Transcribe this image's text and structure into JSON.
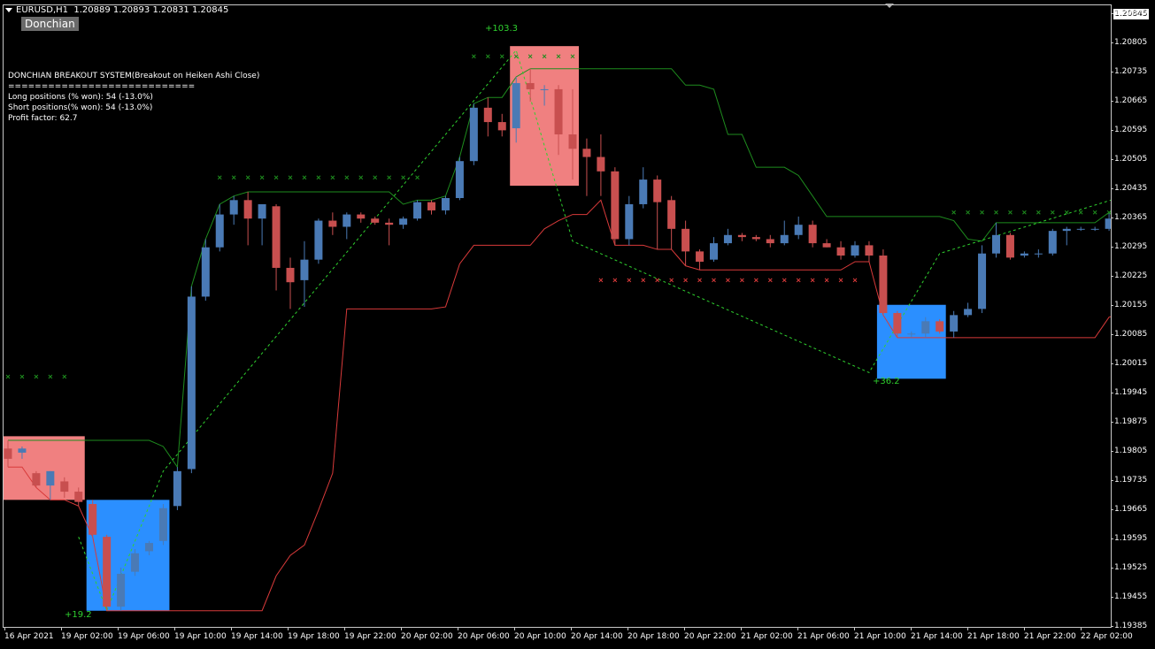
{
  "symbol": {
    "name": "EURUSD,H1",
    "ohlc": "1.20889 1.20893 1.20831 1.20845"
  },
  "indicator_button": "Donchian",
  "stats": {
    "title": "DONCHIAN BREAKOUT SYSTEM(Breakout on Heiken Ashi Close)",
    "separator": "============================",
    "long": "Long positions (% won): 54 (-13.0%)",
    "short": "Short positions(% won): 54 (-13.0%)",
    "profit_factor": "Profit factor: 62.7"
  },
  "current_price": "1.20845",
  "price_axis": [
    "1.20875",
    "1.20805",
    "1.20735",
    "1.20665",
    "1.20595",
    "1.20505",
    "1.20435",
    "1.20365",
    "1.20295",
    "1.20225",
    "1.20155",
    "1.20085",
    "1.20015",
    "1.19945",
    "1.19875",
    "1.19805",
    "1.19735",
    "1.19665",
    "1.19595",
    "1.19525",
    "1.19455",
    "1.19385"
  ],
  "time_axis": [
    "16 Apr 2021",
    "19 Apr 02:00",
    "19 Apr 06:00",
    "19 Apr 10:00",
    "19 Apr 14:00",
    "19 Apr 18:00",
    "19 Apr 22:00",
    "20 Apr 02:00",
    "20 Apr 06:00",
    "20 Apr 10:00",
    "20 Apr 14:00",
    "20 Apr 18:00",
    "20 Apr 22:00",
    "21 Apr 02:00",
    "21 Apr 06:00",
    "21 Apr 10:00",
    "21 Apr 14:00",
    "21 Apr 18:00",
    "21 Apr 22:00",
    "22 Apr 02:00"
  ],
  "trade_labels": [
    "+19.2",
    "+103.3",
    "+36.2"
  ],
  "colors": {
    "background": "#000000",
    "bull": "#4a7ab5",
    "bear": "#c84f4f",
    "upper_channel": "#1e8c1e",
    "lower_channel": "#d83a3a",
    "long_box": "#2b8fff",
    "short_box": "#f08080",
    "trade_line": "#2fd12f",
    "label": "#2fd12f"
  },
  "chart_data": {
    "type": "candlestick",
    "symbol": "EURUSD",
    "timeframe": "H1",
    "yrange": [
      1.19385,
      1.20875
    ],
    "candles": [
      {
        "o": 1.19815,
        "h": 1.19835,
        "l": 1.1977,
        "c": 1.1979
      },
      {
        "o": 1.19805,
        "h": 1.1982,
        "l": 1.1979,
        "c": 1.19815
      },
      {
        "o": 1.19755,
        "h": 1.1976,
        "l": 1.1972,
        "c": 1.19725
      },
      {
        "o": 1.19725,
        "h": 1.1976,
        "l": 1.1969,
        "c": 1.1976
      },
      {
        "o": 1.19735,
        "h": 1.19745,
        "l": 1.19695,
        "c": 1.1971
      },
      {
        "o": 1.1971,
        "h": 1.1972,
        "l": 1.19675,
        "c": 1.19685
      },
      {
        "o": 1.1968,
        "h": 1.1969,
        "l": 1.196,
        "c": 1.19605
      },
      {
        "o": 1.196,
        "h": 1.19605,
        "l": 1.1942,
        "c": 1.1943
      },
      {
        "o": 1.1943,
        "h": 1.19525,
        "l": 1.1942,
        "c": 1.1951
      },
      {
        "o": 1.19515,
        "h": 1.1957,
        "l": 1.19505,
        "c": 1.1956
      },
      {
        "o": 1.19565,
        "h": 1.1959,
        "l": 1.19555,
        "c": 1.19585
      },
      {
        "o": 1.1959,
        "h": 1.1968,
        "l": 1.1958,
        "c": 1.1967
      },
      {
        "o": 1.19675,
        "h": 1.1977,
        "l": 1.19665,
        "c": 1.1976
      },
      {
        "o": 1.19765,
        "h": 1.2021,
        "l": 1.19755,
        "c": 1.20185
      },
      {
        "o": 1.20185,
        "h": 1.20325,
        "l": 1.20175,
        "c": 1.20305
      },
      {
        "o": 1.20305,
        "h": 1.2041,
        "l": 1.20295,
        "c": 1.20385
      },
      {
        "o": 1.20385,
        "h": 1.2043,
        "l": 1.2036,
        "c": 1.2042
      },
      {
        "o": 1.2042,
        "h": 1.2044,
        "l": 1.2031,
        "c": 1.20375
      },
      {
        "o": 1.20375,
        "h": 1.2041,
        "l": 1.2031,
        "c": 1.2041
      },
      {
        "o": 1.20405,
        "h": 1.2041,
        "l": 1.202,
        "c": 1.20255
      },
      {
        "o": 1.20255,
        "h": 1.2028,
        "l": 1.20155,
        "c": 1.2022
      },
      {
        "o": 1.20225,
        "h": 1.2032,
        "l": 1.2016,
        "c": 1.20275
      },
      {
        "o": 1.20275,
        "h": 1.20375,
        "l": 1.20265,
        "c": 1.2037
      },
      {
        "o": 1.2037,
        "h": 1.2039,
        "l": 1.20335,
        "c": 1.20355
      },
      {
        "o": 1.20355,
        "h": 1.2039,
        "l": 1.20325,
        "c": 1.20385
      },
      {
        "o": 1.20385,
        "h": 1.2039,
        "l": 1.20365,
        "c": 1.20375
      },
      {
        "o": 1.20375,
        "h": 1.2038,
        "l": 1.2036,
        "c": 1.20365
      },
      {
        "o": 1.20365,
        "h": 1.20375,
        "l": 1.2031,
        "c": 1.2036
      },
      {
        "o": 1.2036,
        "h": 1.2038,
        "l": 1.2035,
        "c": 1.20375
      },
      {
        "o": 1.20375,
        "h": 1.2042,
        "l": 1.2037,
        "c": 1.20415
      },
      {
        "o": 1.20415,
        "h": 1.2042,
        "l": 1.20385,
        "c": 1.20395
      },
      {
        "o": 1.20395,
        "h": 1.2043,
        "l": 1.20385,
        "c": 1.20425
      },
      {
        "o": 1.20425,
        "h": 1.20525,
        "l": 1.2042,
        "c": 1.20515
      },
      {
        "o": 1.20515,
        "h": 1.20655,
        "l": 1.20505,
        "c": 1.20645
      },
      {
        "o": 1.20645,
        "h": 1.2067,
        "l": 1.20575,
        "c": 1.2061
      },
      {
        "o": 1.2061,
        "h": 1.2063,
        "l": 1.20575,
        "c": 1.2059
      },
      {
        "o": 1.20595,
        "h": 1.2072,
        "l": 1.2056,
        "c": 1.20705
      },
      {
        "o": 1.20705,
        "h": 1.2074,
        "l": 1.2066,
        "c": 1.2069
      },
      {
        "o": 1.2069,
        "h": 1.207,
        "l": 1.2065,
        "c": 1.2069
      },
      {
        "o": 1.2069,
        "h": 1.207,
        "l": 1.2053,
        "c": 1.2058
      },
      {
        "o": 1.2058,
        "h": 1.2069,
        "l": 1.2047,
        "c": 1.20545
      },
      {
        "o": 1.20545,
        "h": 1.2057,
        "l": 1.2043,
        "c": 1.20525
      },
      {
        "o": 1.20525,
        "h": 1.2058,
        "l": 1.2043,
        "c": 1.2049
      },
      {
        "o": 1.2049,
        "h": 1.205,
        "l": 1.2031,
        "c": 1.20325
      },
      {
        "o": 1.20325,
        "h": 1.2043,
        "l": 1.2031,
        "c": 1.2041
      },
      {
        "o": 1.2041,
        "h": 1.205,
        "l": 1.204,
        "c": 1.2047
      },
      {
        "o": 1.2047,
        "h": 1.2048,
        "l": 1.203,
        "c": 1.20415
      },
      {
        "o": 1.2042,
        "h": 1.2043,
        "l": 1.203,
        "c": 1.2035
      },
      {
        "o": 1.2035,
        "h": 1.2037,
        "l": 1.2026,
        "c": 1.20295
      },
      {
        "o": 1.20295,
        "h": 1.203,
        "l": 1.2025,
        "c": 1.2027
      },
      {
        "o": 1.20275,
        "h": 1.2033,
        "l": 1.2027,
        "c": 1.20315
      },
      {
        "o": 1.20315,
        "h": 1.2035,
        "l": 1.2031,
        "c": 1.20335
      },
      {
        "o": 1.20335,
        "h": 1.2034,
        "l": 1.2032,
        "c": 1.2033
      },
      {
        "o": 1.2033,
        "h": 1.20335,
        "l": 1.2032,
        "c": 1.20325
      },
      {
        "o": 1.20325,
        "h": 1.20335,
        "l": 1.20305,
        "c": 1.20315
      },
      {
        "o": 1.20315,
        "h": 1.2037,
        "l": 1.2031,
        "c": 1.20335
      },
      {
        "o": 1.20335,
        "h": 1.2038,
        "l": 1.20325,
        "c": 1.2036
      },
      {
        "o": 1.2036,
        "h": 1.2037,
        "l": 1.20305,
        "c": 1.20315
      },
      {
        "o": 1.20315,
        "h": 1.20325,
        "l": 1.20305,
        "c": 1.20305
      },
      {
        "o": 1.20305,
        "h": 1.2032,
        "l": 1.20275,
        "c": 1.20285
      },
      {
        "o": 1.20285,
        "h": 1.2032,
        "l": 1.2028,
        "c": 1.2031
      },
      {
        "o": 1.2031,
        "h": 1.2032,
        "l": 1.2027,
        "c": 1.20285
      },
      {
        "o": 1.20285,
        "h": 1.203,
        "l": 1.2014,
        "c": 1.20145
      },
      {
        "o": 1.20145,
        "h": 1.2015,
        "l": 1.20085,
        "c": 1.20095
      },
      {
        "o": 1.20095,
        "h": 1.201,
        "l": 1.20085,
        "c": 1.20095
      },
      {
        "o": 1.20095,
        "h": 1.20135,
        "l": 1.20085,
        "c": 1.20125
      },
      {
        "o": 1.20125,
        "h": 1.2013,
        "l": 1.20095,
        "c": 1.201
      },
      {
        "o": 1.201,
        "h": 1.2015,
        "l": 1.20085,
        "c": 1.2014
      },
      {
        "o": 1.2014,
        "h": 1.2017,
        "l": 1.20135,
        "c": 1.20155
      },
      {
        "o": 1.20155,
        "h": 1.2031,
        "l": 1.20145,
        "c": 1.2029
      },
      {
        "o": 1.2029,
        "h": 1.20365,
        "l": 1.2028,
        "c": 1.20335
      },
      {
        "o": 1.20335,
        "h": 1.2034,
        "l": 1.20275,
        "c": 1.2028
      },
      {
        "o": 1.20285,
        "h": 1.20295,
        "l": 1.2028,
        "c": 1.2029
      },
      {
        "o": 1.2029,
        "h": 1.203,
        "l": 1.2028,
        "c": 1.2029
      },
      {
        "o": 1.2029,
        "h": 1.2035,
        "l": 1.20285,
        "c": 1.20345
      },
      {
        "o": 1.20345,
        "h": 1.20355,
        "l": 1.2031,
        "c": 1.2035
      },
      {
        "o": 1.2035,
        "h": 1.20355,
        "l": 1.20345,
        "c": 1.2035
      },
      {
        "o": 1.2035,
        "h": 1.20355,
        "l": 1.20345,
        "c": 1.2035
      },
      {
        "o": 1.2035,
        "h": 1.2039,
        "l": 1.20345,
        "c": 1.20375
      },
      {
        "o": 1.20375,
        "h": 1.204,
        "l": 1.20365,
        "c": 1.2037
      },
      {
        "o": 1.2038,
        "h": 1.2044,
        "l": 1.2037,
        "c": 1.2043
      }
    ]
  }
}
